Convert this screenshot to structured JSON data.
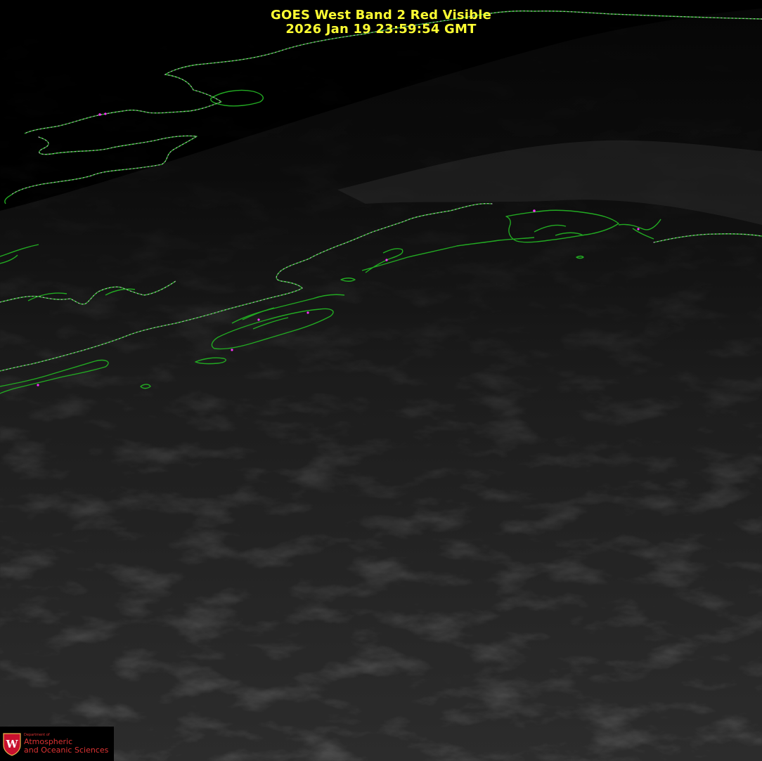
{
  "header": {
    "title_line1": "GOES West Band 2 Red Visible",
    "title_line2": "2026 Jan 19  23:59:54 GMT"
  },
  "logo": {
    "crest_letter": "W",
    "dept": "Department of",
    "line1": "Atmospheric",
    "line2": "and Oceanic Sciences"
  },
  "colors": {
    "title": "#ffff33",
    "coastline": "#22aa22",
    "border_dots": "#c8a0c8",
    "logo_red": "#c8102e"
  }
}
